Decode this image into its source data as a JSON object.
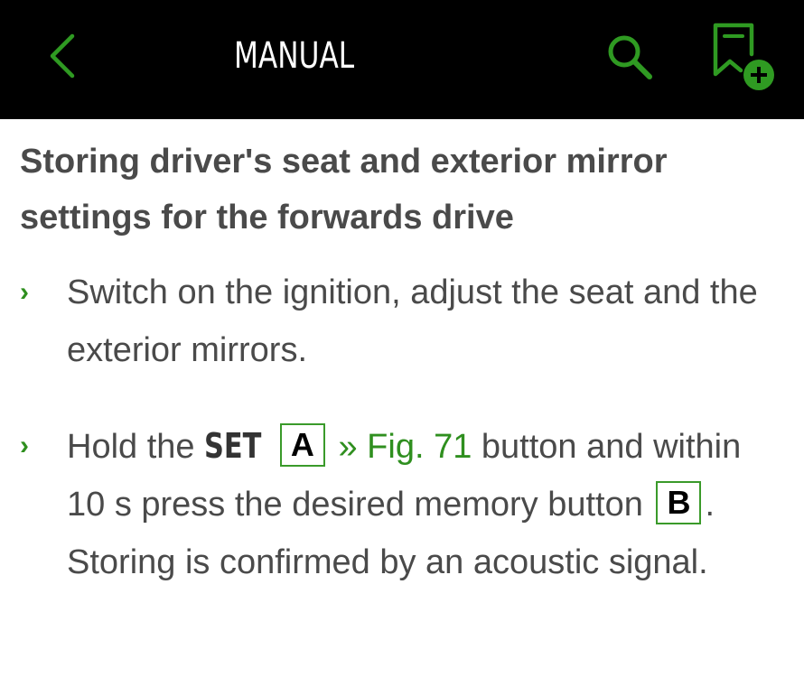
{
  "header": {
    "title": "MANUAL",
    "back_icon": "chevron-left-icon",
    "search_icon": "search-icon",
    "bookmark_icon": "bookmark-add-icon"
  },
  "colors": {
    "accent": "#2f8f1f",
    "topbar_bg": "#000000",
    "text": "#4a4a4a"
  },
  "section": {
    "heading": "Storing driver's seat and exterior mirror settings for the forwards drive",
    "steps": [
      {
        "marker": "›",
        "text": "Switch on the ignition, adjust the seat and the exterior mirrors."
      },
      {
        "marker": "›",
        "part1": "Hold the ",
        "set_label": "SET",
        "key_a": "A",
        "fig_ref": "» Fig. 71",
        "part2": " button and within 10 s press the desired memory button ",
        "key_b": "B",
        "part3": ". Storing is confirmed by an acoustic signal."
      }
    ]
  }
}
